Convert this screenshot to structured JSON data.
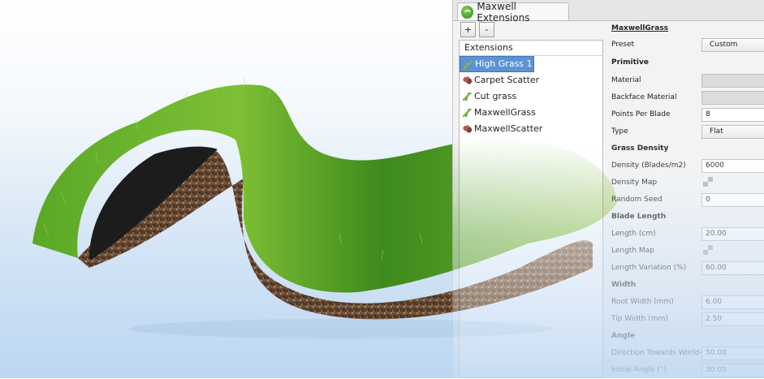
{
  "window": {
    "tab_title": "Maxwell Extensions",
    "add_label": "+",
    "remove_label": "-"
  },
  "extensions": {
    "header": "Extensions",
    "items": [
      {
        "label": "High Grass 1",
        "icon": "grass-icon",
        "selected": true
      },
      {
        "label": "Carpet Scatter",
        "icon": "scatter-icon",
        "selected": false
      },
      {
        "label": "Cut grass",
        "icon": "grass-icon",
        "selected": false
      },
      {
        "label": "MaxwellGrass",
        "icon": "grass-icon",
        "selected": false
      },
      {
        "label": "MaxwellScatter",
        "icon": "scatter-icon",
        "selected": false
      }
    ]
  },
  "properties": {
    "title": "MaxwellGrass",
    "preset": {
      "label": "Preset",
      "value": "Custom"
    },
    "primitive": "Primitive",
    "material": {
      "label": "Material"
    },
    "backface_material": {
      "label": "Backface Material"
    },
    "points_per_blade": {
      "label": "Points Per Blade",
      "value": "8"
    },
    "type": {
      "label": "Type",
      "value": "Flat"
    },
    "grass_density": "Grass Density",
    "density": {
      "label": "Density (Blades/m2)",
      "value": "6000"
    },
    "density_map": {
      "label": "Density Map"
    },
    "random_seed": {
      "label": "Random Seed",
      "value": "0"
    },
    "blade_length": "Blade Length",
    "length": {
      "label": "Length (cm)",
      "value": "20.00"
    },
    "length_map": {
      "label": "Length Map"
    },
    "length_variation": {
      "label": "Length Variation (%)",
      "value": "60.00"
    },
    "width": "Width",
    "root_width": {
      "label": "Root Width (mm)",
      "value": "6.00"
    },
    "tip_width": {
      "label": "Tip Width (mm)",
      "value": "2.50"
    },
    "angle": "Angle",
    "direction_world_y": {
      "label": "Direction Towards World-Y (%)",
      "value": "50.00"
    },
    "initial_angle": {
      "label": "Initial Angle (°)",
      "value": "30.00"
    }
  },
  "colors": {
    "selection": "#5b93d6",
    "grass_dark": "#2f7a18",
    "grass_light": "#7cc23a",
    "soil": "#6b4a33"
  }
}
